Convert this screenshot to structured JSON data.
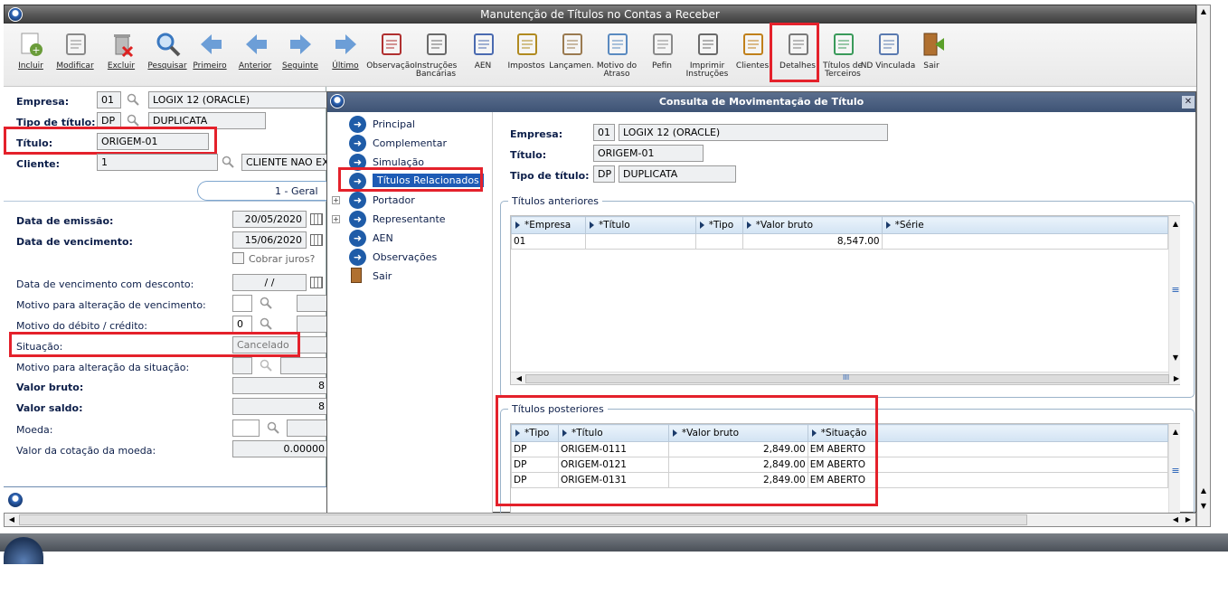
{
  "window": {
    "title": "Manutenção de Títulos no Contas a Receber"
  },
  "toolbar": [
    {
      "label": "Incluir",
      "icon": "add-icon"
    },
    {
      "label": "Modificar",
      "icon": "edit-pencil-icon"
    },
    {
      "label": "Excluir",
      "icon": "trash-icon"
    },
    {
      "label": "Pesquisar",
      "icon": "search-icon"
    },
    {
      "label": "Primeiro",
      "icon": "first-arrow-icon"
    },
    {
      "label": "Anterior",
      "icon": "previous-arrow-icon"
    },
    {
      "label": "Seguinte",
      "icon": "next-arrow-icon"
    },
    {
      "label": "Último",
      "icon": "last-arrow-icon"
    },
    {
      "label": "Observação",
      "icon": "note-icon"
    },
    {
      "label": "Instruções Bancárias",
      "icon": "bank-instructions-icon"
    },
    {
      "label": "AEN",
      "icon": "document-icon"
    },
    {
      "label": "Impostos",
      "icon": "scale-icon"
    },
    {
      "label": "Lançamen.",
      "icon": "entry-icon"
    },
    {
      "label": "Motivo do Atraso",
      "icon": "delay-reason-icon"
    },
    {
      "label": "Pefin",
      "icon": "pefin-icon"
    },
    {
      "label": "Imprimir Instruções",
      "icon": "printer-icon"
    },
    {
      "label": "Clientes",
      "icon": "clients-icon"
    },
    {
      "label": "Detalhes",
      "icon": "details-icon"
    },
    {
      "label": "Títulos de Terceiros",
      "icon": "third-party-titles-icon"
    },
    {
      "label": "ND Vinculada",
      "icon": "linked-nd-icon"
    },
    {
      "label": "Sair",
      "icon": "exit-door-icon"
    }
  ],
  "form": {
    "empresa": {
      "label": "Empresa:",
      "code": "01",
      "name": "LOGIX 12 (ORACLE)"
    },
    "tipo": {
      "label": "Tipo de título:",
      "code": "DP",
      "name": "DUPLICATA"
    },
    "titulo": {
      "label": "Título:",
      "value": "ORIGEM-01"
    },
    "cliente": {
      "label": "Cliente:",
      "code": "1",
      "name": "CLIENTE NAO EXC"
    },
    "tab": "1 - Geral",
    "emissao": {
      "label": "Data de emissão:",
      "value": "20/05/2020"
    },
    "vencimento": {
      "label": "Data de vencimento:",
      "value": "15/06/2020"
    },
    "cobrar_juros": "Cobrar juros?",
    "venc_desconto": {
      "label": "Data de vencimento com desconto:",
      "value": "/ /"
    },
    "motivo_venc": {
      "label": "Motivo para alteração de vencimento:"
    },
    "motivo_debito": {
      "label": "Motivo do débito / crédito:",
      "value": "0"
    },
    "situacao": {
      "label": "Situação:",
      "value": "Cancelado"
    },
    "motivo_situacao": {
      "label": "Motivo para alteração da situação:"
    },
    "valor_bruto": {
      "label": "Valor bruto:",
      "value": "8"
    },
    "valor_saldo": {
      "label": "Valor saldo:",
      "value": "8"
    },
    "moeda": {
      "label": "Moeda:"
    },
    "cotacao": {
      "label": "Valor da cotação da moeda:",
      "value": "0.00000"
    }
  },
  "dialog": {
    "title": "Consulta de Movimentação de Título",
    "tree": [
      {
        "label": "Principal",
        "type": "arrow"
      },
      {
        "label": "Complementar",
        "type": "arrow"
      },
      {
        "label": "Simulação",
        "type": "arrow"
      },
      {
        "label": "Títulos Relacionados",
        "type": "arrow",
        "selected": true
      },
      {
        "label": "Portador",
        "type": "arrow",
        "expander": true
      },
      {
        "label": "Representante",
        "type": "arrow",
        "expander": true
      },
      {
        "label": "AEN",
        "type": "arrow"
      },
      {
        "label": "Observações",
        "type": "arrow"
      },
      {
        "label": "Sair",
        "type": "door"
      }
    ],
    "empresa": {
      "label": "Empresa:",
      "code": "01",
      "name": "LOGIX 12 (ORACLE)"
    },
    "titulo": {
      "label": "Título:",
      "value": "ORIGEM-01"
    },
    "tipo": {
      "label": "Tipo de título:",
      "code": "DP",
      "name": "DUPLICATA"
    },
    "anteriores": {
      "title": "Títulos anteriores",
      "columns": [
        "*Empresa",
        "*Título",
        "*Tipo",
        "*Valor bruto",
        "*Série"
      ],
      "rows": [
        [
          "01",
          "",
          "",
          "8,547.00",
          ""
        ]
      ]
    },
    "posteriores": {
      "title": "Títulos posteriores",
      "columns": [
        "*Tipo",
        "*Título",
        "*Valor bruto",
        "*Situação"
      ],
      "rows": [
        [
          "DP",
          "ORIGEM-0111",
          "2,849.00",
          "EM ABERTO"
        ],
        [
          "DP",
          "ORIGEM-0121",
          "2,849.00",
          "EM ABERTO"
        ],
        [
          "DP",
          "ORIGEM-0131",
          "2,849.00",
          "EM ABERTO"
        ]
      ]
    }
  },
  "colors": {
    "highlight": "#e4212b",
    "selection": "#1e5bb5",
    "titlebar": "#4a4a4a"
  }
}
